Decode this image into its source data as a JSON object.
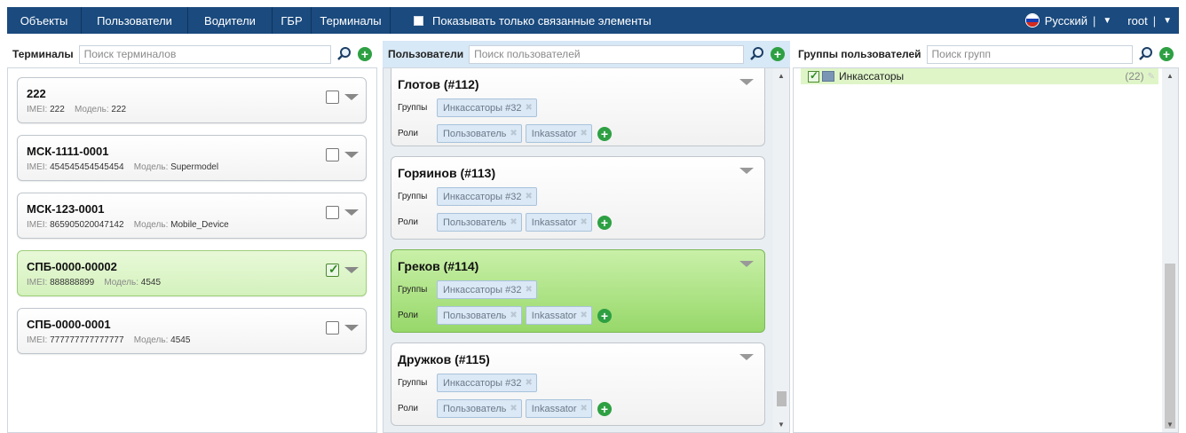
{
  "nav": {
    "items": [
      "Объекты",
      "Пользователи",
      "Водители",
      "ГБР",
      "Терминалы"
    ],
    "show_linked_label": "Показывать только связанные элементы",
    "language": "Русский",
    "user": "root"
  },
  "terminals": {
    "title": "Терминалы",
    "search_placeholder": "Поиск терминалов",
    "imei_label": "IMEI:",
    "model_label": "Модель:",
    "items": [
      {
        "name": "222",
        "imei": "222",
        "model": "222",
        "checked": false
      },
      {
        "name": "МСК-1111-0001",
        "imei": "454545454545454",
        "model": "Supermodel",
        "checked": false
      },
      {
        "name": "МСК-123-0001",
        "imei": "865905020047142",
        "model": "Mobile_Device",
        "checked": false
      },
      {
        "name": "СПБ-0000-00002",
        "imei": "888888899",
        "model": "4545",
        "checked": true
      },
      {
        "name": "СПБ-0000-0001",
        "imei": "777777777777777",
        "model": "4545",
        "checked": false
      }
    ]
  },
  "users": {
    "title": "Пользователи",
    "search_placeholder": "Поиск пользователей",
    "groups_label": "Группы",
    "roles_label": "Роли",
    "items": [
      {
        "name": "Глотов (#112)",
        "group": "Инкассаторы #32",
        "role1": "Пользователь",
        "role2": "Inkassator",
        "selected": false
      },
      {
        "name": "Горяинов (#113)",
        "group": "Инкассаторы #32",
        "role1": "Пользователь",
        "role2": "Inkassator",
        "selected": false
      },
      {
        "name": "Греков (#114)",
        "group": "Инкассаторы #32",
        "role1": "Пользователь",
        "role2": "Inkassator",
        "selected": true
      },
      {
        "name": "Дружков (#115)",
        "group": "Инкассаторы #32",
        "role1": "Пользователь",
        "role2": "Inkassator",
        "selected": false
      }
    ]
  },
  "groups": {
    "title": "Группы пользователей",
    "search_placeholder": "Поиск групп",
    "items": [
      {
        "name": "Инкассаторы",
        "count": "(22)"
      }
    ]
  },
  "colors": {
    "nav_bg": "#1a4a7e",
    "selected_green": "#97d86a",
    "add_green": "#2ea043"
  }
}
